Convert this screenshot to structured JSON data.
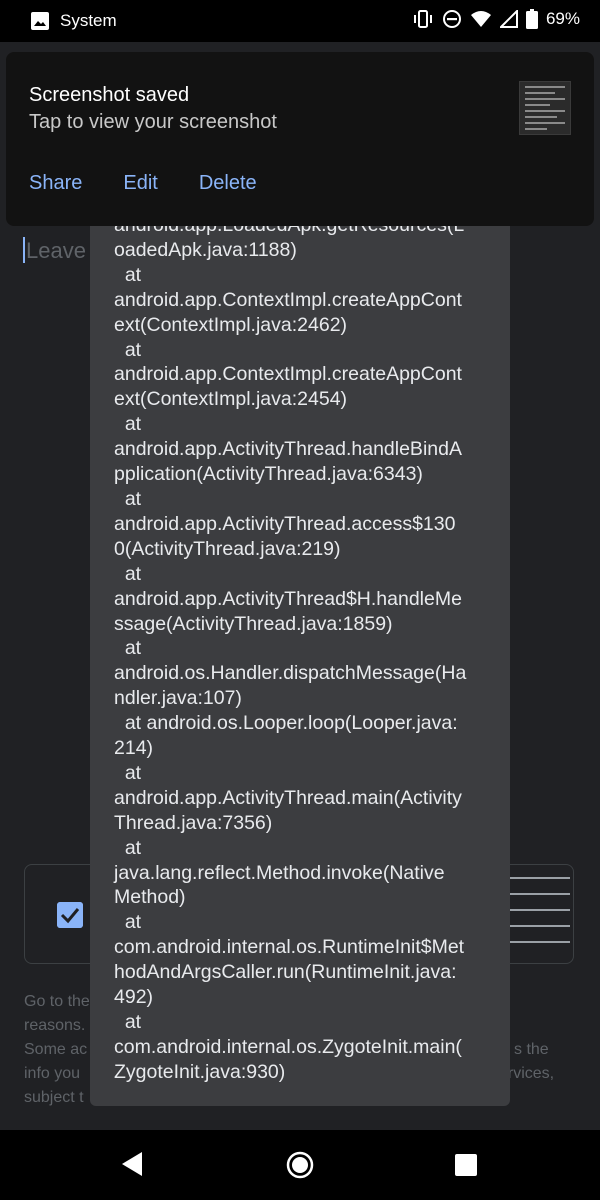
{
  "status_bar": {
    "app_label": "System",
    "battery": "69%"
  },
  "notification": {
    "title": "Screenshot saved",
    "text": "Tap to view your screenshot",
    "actions": [
      "Share",
      "Edit",
      "Delete"
    ]
  },
  "background": {
    "input_placeholder": "Leave",
    "footer_lines": [
      "Go to the",
      "reasons.",
      "Some ac",
      "info you",
      "subject t"
    ],
    "footer_right_lines": [
      "s the",
      "ervices,"
    ]
  },
  "dialog": {
    "stack_trace": "android.app.LoadedApk.getResources(L\noadedApk.java:1188)\n  at\nandroid.app.ContextImpl.createAppCont\next(ContextImpl.java:2462)\n  at\nandroid.app.ContextImpl.createAppCont\next(ContextImpl.java:2454)\n  at\nandroid.app.ActivityThread.handleBindA\npplication(ActivityThread.java:6343)\n  at\nandroid.app.ActivityThread.access$130\n0(ActivityThread.java:219)\n  at\nandroid.app.ActivityThread$H.handleMe\nssage(ActivityThread.java:1859)\n  at\nandroid.os.Handler.dispatchMessage(Ha\nndler.java:107)\n  at android.os.Looper.loop(Looper.java:\n214)\n  at\nandroid.app.ActivityThread.main(Activity\nThread.java:7356)\n  at\njava.lang.reflect.Method.invoke(Native\nMethod)\n  at\ncom.android.internal.os.RuntimeInit$Met\nhodAndArgsCaller.run(RuntimeInit.java:\n492)\n  at\ncom.android.internal.os.ZygoteInit.main(\nZygoteInit.java:930)"
  },
  "icons": {
    "app": "image-icon",
    "vibrate": "vibrate-icon",
    "dnd": "do-not-disturb-icon",
    "wifi": "wifi-icon",
    "signal": "cell-signal-icon",
    "battery": "battery-icon",
    "back": "back-icon",
    "home": "home-icon",
    "recents": "recents-icon"
  },
  "colors": {
    "accent": "#8ab4f8",
    "background": "#202124",
    "dialog": "#3c3d40",
    "notification": "#121212"
  }
}
